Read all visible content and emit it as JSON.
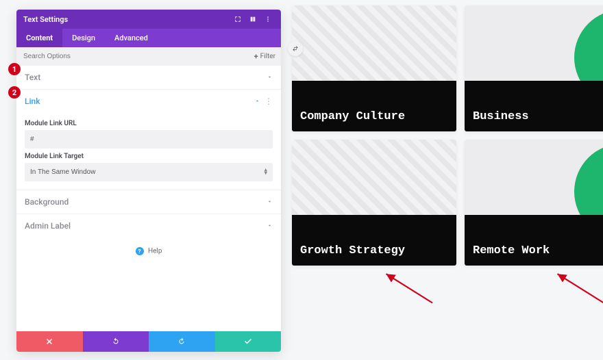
{
  "panel": {
    "title": "Text Settings",
    "tabs": {
      "content": "Content",
      "design": "Design",
      "advanced": "Advanced"
    },
    "search": {
      "placeholder": "Search Options",
      "filter_label": "Filter"
    },
    "sections": {
      "text": "Text",
      "link": "Link",
      "background": "Background",
      "admin_label": "Admin Label"
    },
    "link": {
      "url_label": "Module Link URL",
      "url_value": "#",
      "target_label": "Module Link Target",
      "target_value": "In The Same Window"
    },
    "help_label": "Help"
  },
  "annotations": {
    "one": "1",
    "two": "2"
  },
  "cards": {
    "a": "Company Culture",
    "b": "Business",
    "c": "Growth Strategy",
    "d": "Remote Work"
  }
}
